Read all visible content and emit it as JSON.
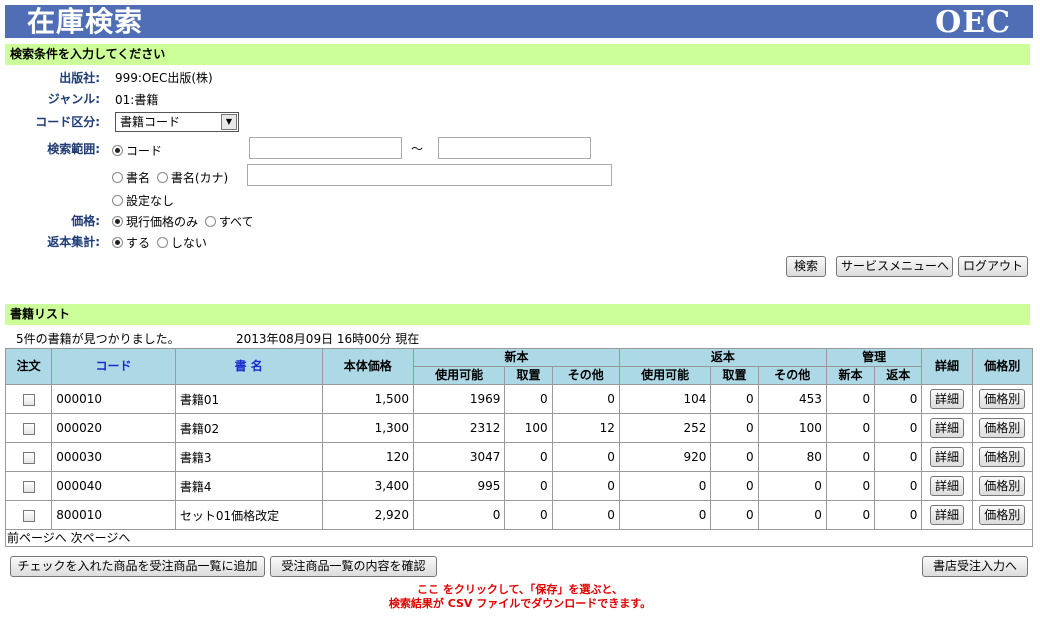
{
  "header": {
    "title": "在庫検索",
    "logo": "OEC"
  },
  "search": {
    "section_title": "検索条件を入力してください",
    "publisher_label": "出版社:",
    "publisher_value": "999:OEC出版(株)",
    "genre_label": "ジャンル:",
    "genre_value": "01:書籍",
    "code_type_label": "コード区分:",
    "code_type_selected": "書籍コード",
    "range_label": "検索範囲:",
    "range_option_code": "コード",
    "range_tilde": "〜",
    "range_option_name": "書名",
    "range_option_kana": "書名(カナ)",
    "range_option_none": "設定なし",
    "price_label": "価格:",
    "price_option_current": "現行価格のみ",
    "price_option_all": "すべて",
    "return_label": "返本集計:",
    "return_option_yes": "する",
    "return_option_no": "しない",
    "search_button": "検索",
    "service_menu_button": "サービスメニューへ",
    "logout_button": "ログアウト"
  },
  "list": {
    "section_title": "書籍リスト",
    "found_text": "5件の書籍が見つかりました。",
    "timestamp_text": "2013年08月09日 16時00分 現在",
    "headers": {
      "order": "注文",
      "code": "コード",
      "title": "書 名",
      "price": "本体価格",
      "new_group": "新本",
      "return_group": "返本",
      "manage_group": "管理",
      "detail": "詳細",
      "price_detail": "価格別",
      "usable": "使用可能",
      "reserved": "取置",
      "other": "その他",
      "manage_new": "新本",
      "manage_return": "返本"
    },
    "rows": [
      {
        "code": "000010",
        "title": "書籍01",
        "price": "1,500",
        "new_usable": "1969",
        "new_reserved": "0",
        "new_other": "0",
        "ret_usable": "104",
        "ret_reserved": "0",
        "ret_other": "453",
        "mgmt_new": "0",
        "mgmt_return": "0",
        "detail": "詳細",
        "price_btn": "価格別"
      },
      {
        "code": "000020",
        "title": "書籍02",
        "price": "1,300",
        "new_usable": "2312",
        "new_reserved": "100",
        "new_other": "12",
        "ret_usable": "252",
        "ret_reserved": "0",
        "ret_other": "100",
        "mgmt_new": "0",
        "mgmt_return": "0",
        "detail": "詳細",
        "price_btn": "価格別"
      },
      {
        "code": "000030",
        "title": "書籍3",
        "price": "120",
        "new_usable": "3047",
        "new_reserved": "0",
        "new_other": "0",
        "ret_usable": "920",
        "ret_reserved": "0",
        "ret_other": "80",
        "mgmt_new": "0",
        "mgmt_return": "0",
        "detail": "詳細",
        "price_btn": "価格別"
      },
      {
        "code": "000040",
        "title": "書籍4",
        "price": "3,400",
        "new_usable": "995",
        "new_reserved": "0",
        "new_other": "0",
        "ret_usable": "0",
        "ret_reserved": "0",
        "ret_other": "0",
        "mgmt_new": "0",
        "mgmt_return": "0",
        "detail": "詳細",
        "price_btn": "価格別"
      },
      {
        "code": "800010",
        "title": "セット01価格改定",
        "price": "2,920",
        "new_usable": "0",
        "new_reserved": "0",
        "new_other": "0",
        "ret_usable": "0",
        "ret_reserved": "0",
        "ret_other": "0",
        "mgmt_new": "0",
        "mgmt_return": "0",
        "detail": "詳細",
        "price_btn": "価格別"
      }
    ],
    "prev_page": "前ページへ",
    "next_page": "次ページへ",
    "add_checked_button": "チェックを入れた商品を受注商品一覧に追加",
    "confirm_button": "受注商品一覧の内容を確認",
    "shop_order_button": "書店受注入力へ"
  },
  "footer": {
    "link_text": "ここ",
    "line1_rest": " をクリックして、「保存」を選ぶと、",
    "line2": "検索結果が CSV ファイルでダウンロードできます。"
  }
}
